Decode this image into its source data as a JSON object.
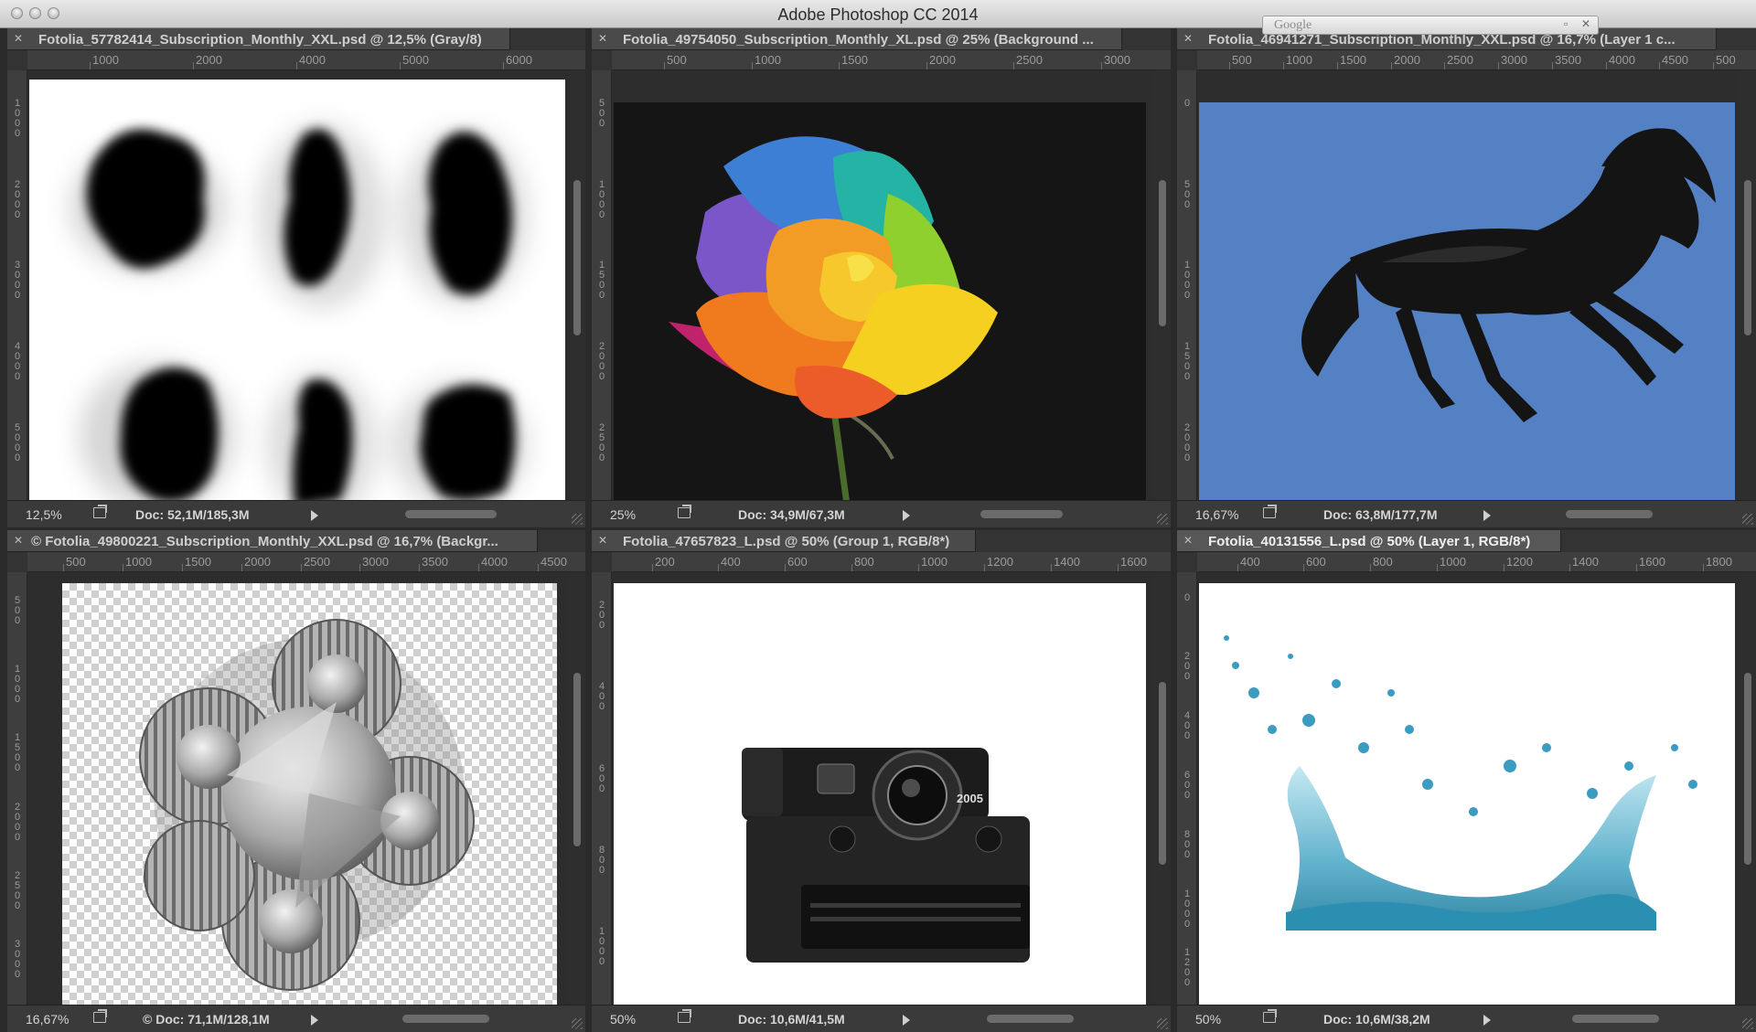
{
  "app": {
    "title": "Adobe Photoshop CC 2014"
  },
  "google_bar": {
    "label": "Google"
  },
  "documents": [
    {
      "tab_title": "Fotolia_57782414_Subscription_Monthly_XXL.psd @ 12,5% (Gray/8)",
      "ruler_h": [
        "1000",
        "2000",
        "4000",
        "5000",
        "6000"
      ],
      "ruler_v": [
        "1000",
        "2000",
        "3000",
        "4000",
        "5000"
      ],
      "zoom": "12,5%",
      "doc_info": "Doc: 52,1M/185,3M",
      "content": "black powder explosions on white"
    },
    {
      "tab_title": "Fotolia_49754050_Subscription_Monthly_XL.psd @ 25% (Background ...",
      "ruler_h": [
        "500",
        "1000",
        "1500",
        "2000",
        "2500",
        "3000"
      ],
      "ruler_v": [
        "500",
        "1000",
        "1500",
        "2000",
        "2500"
      ],
      "zoom": "25%",
      "doc_info": "Doc: 34,9M/67,3M",
      "content": "rainbow rose on black"
    },
    {
      "tab_title": "Fotolia_46941271_Subscription_Monthly_XXL.psd @ 16,7% (Layer 1 c...",
      "ruler_h": [
        "500",
        "1000",
        "1500",
        "2000",
        "2500",
        "3000",
        "3500",
        "4000",
        "4500",
        "500"
      ],
      "ruler_v": [
        "0",
        "500",
        "1000",
        "1500",
        "2000"
      ],
      "zoom": "16,67%",
      "doc_info": "Doc: 63,8M/177,7M",
      "content": "black horse on blue"
    },
    {
      "tab_title": "© Fotolia_49800221_Subscription_Monthly_XXL.psd @ 16,7% (Backgr...",
      "ruler_h": [
        "500",
        "1000",
        "1500",
        "2000",
        "2500",
        "3000",
        "3500",
        "4000",
        "4500"
      ],
      "ruler_v": [
        "500",
        "1000",
        "1500",
        "2000",
        "2500",
        "3000"
      ],
      "zoom": "16,67%",
      "doc_info": "© Doc: 71,1M/128,1M",
      "content": "metal gears on transparent"
    },
    {
      "tab_title": "Fotolia_47657823_L.psd @ 50% (Group 1, RGB/8*)",
      "ruler_h": [
        "200",
        "400",
        "600",
        "800",
        "1000",
        "1200",
        "1400",
        "1600"
      ],
      "ruler_v": [
        "200",
        "400",
        "600",
        "800",
        "1000"
      ],
      "zoom": "50%",
      "doc_info": "Doc: 10,6M/41,5M",
      "content": "instant camera on white"
    },
    {
      "tab_title": "Fotolia_40131556_L.psd @ 50% (Layer 1, RGB/8*)",
      "ruler_h": [
        "400",
        "600",
        "800",
        "1000",
        "1200",
        "1400",
        "1600",
        "1800"
      ],
      "ruler_v": [
        "0",
        "200",
        "400",
        "600",
        "800",
        "1000",
        "1200"
      ],
      "zoom": "50%",
      "doc_info": "Doc: 10,6M/38,2M",
      "content": "water splash on white"
    }
  ],
  "camera": {
    "brand_text": "2005"
  },
  "colors": {
    "horse_bg": "#5480c4",
    "rose_bg": "#151515",
    "chrome": "#3a3a3a"
  }
}
